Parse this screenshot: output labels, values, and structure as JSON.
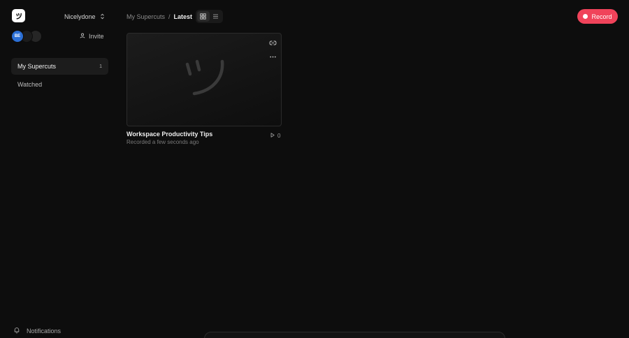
{
  "sidebar": {
    "workspace_name": "Nicelydone",
    "avatars": [
      {
        "initials": "BE",
        "color": "#2b6fd6"
      },
      {
        "initials": "",
        "color": "#1c1c1c"
      },
      {
        "initials": "",
        "color": "#262626"
      }
    ],
    "invite_label": "Invite",
    "nav": [
      {
        "label": "My Supercuts",
        "count": "1",
        "active": true
      },
      {
        "label": "Watched",
        "count": "",
        "active": false
      }
    ],
    "notifications_label": "Notifications"
  },
  "header": {
    "breadcrumb_root": "My Supercuts",
    "breadcrumb_separator": "/",
    "breadcrumb_current": "Latest",
    "view_modes": [
      "grid-icon",
      "list-icon"
    ],
    "active_view": "grid",
    "record_label": "Record"
  },
  "videos": [
    {
      "title": "Workspace Productivity Tips",
      "subtitle": "Recorded a few seconds ago",
      "views": "0"
    }
  ],
  "colors": {
    "background": "#0d0d0d",
    "record": "#f0435a",
    "active_nav": "#1c1c1c"
  }
}
